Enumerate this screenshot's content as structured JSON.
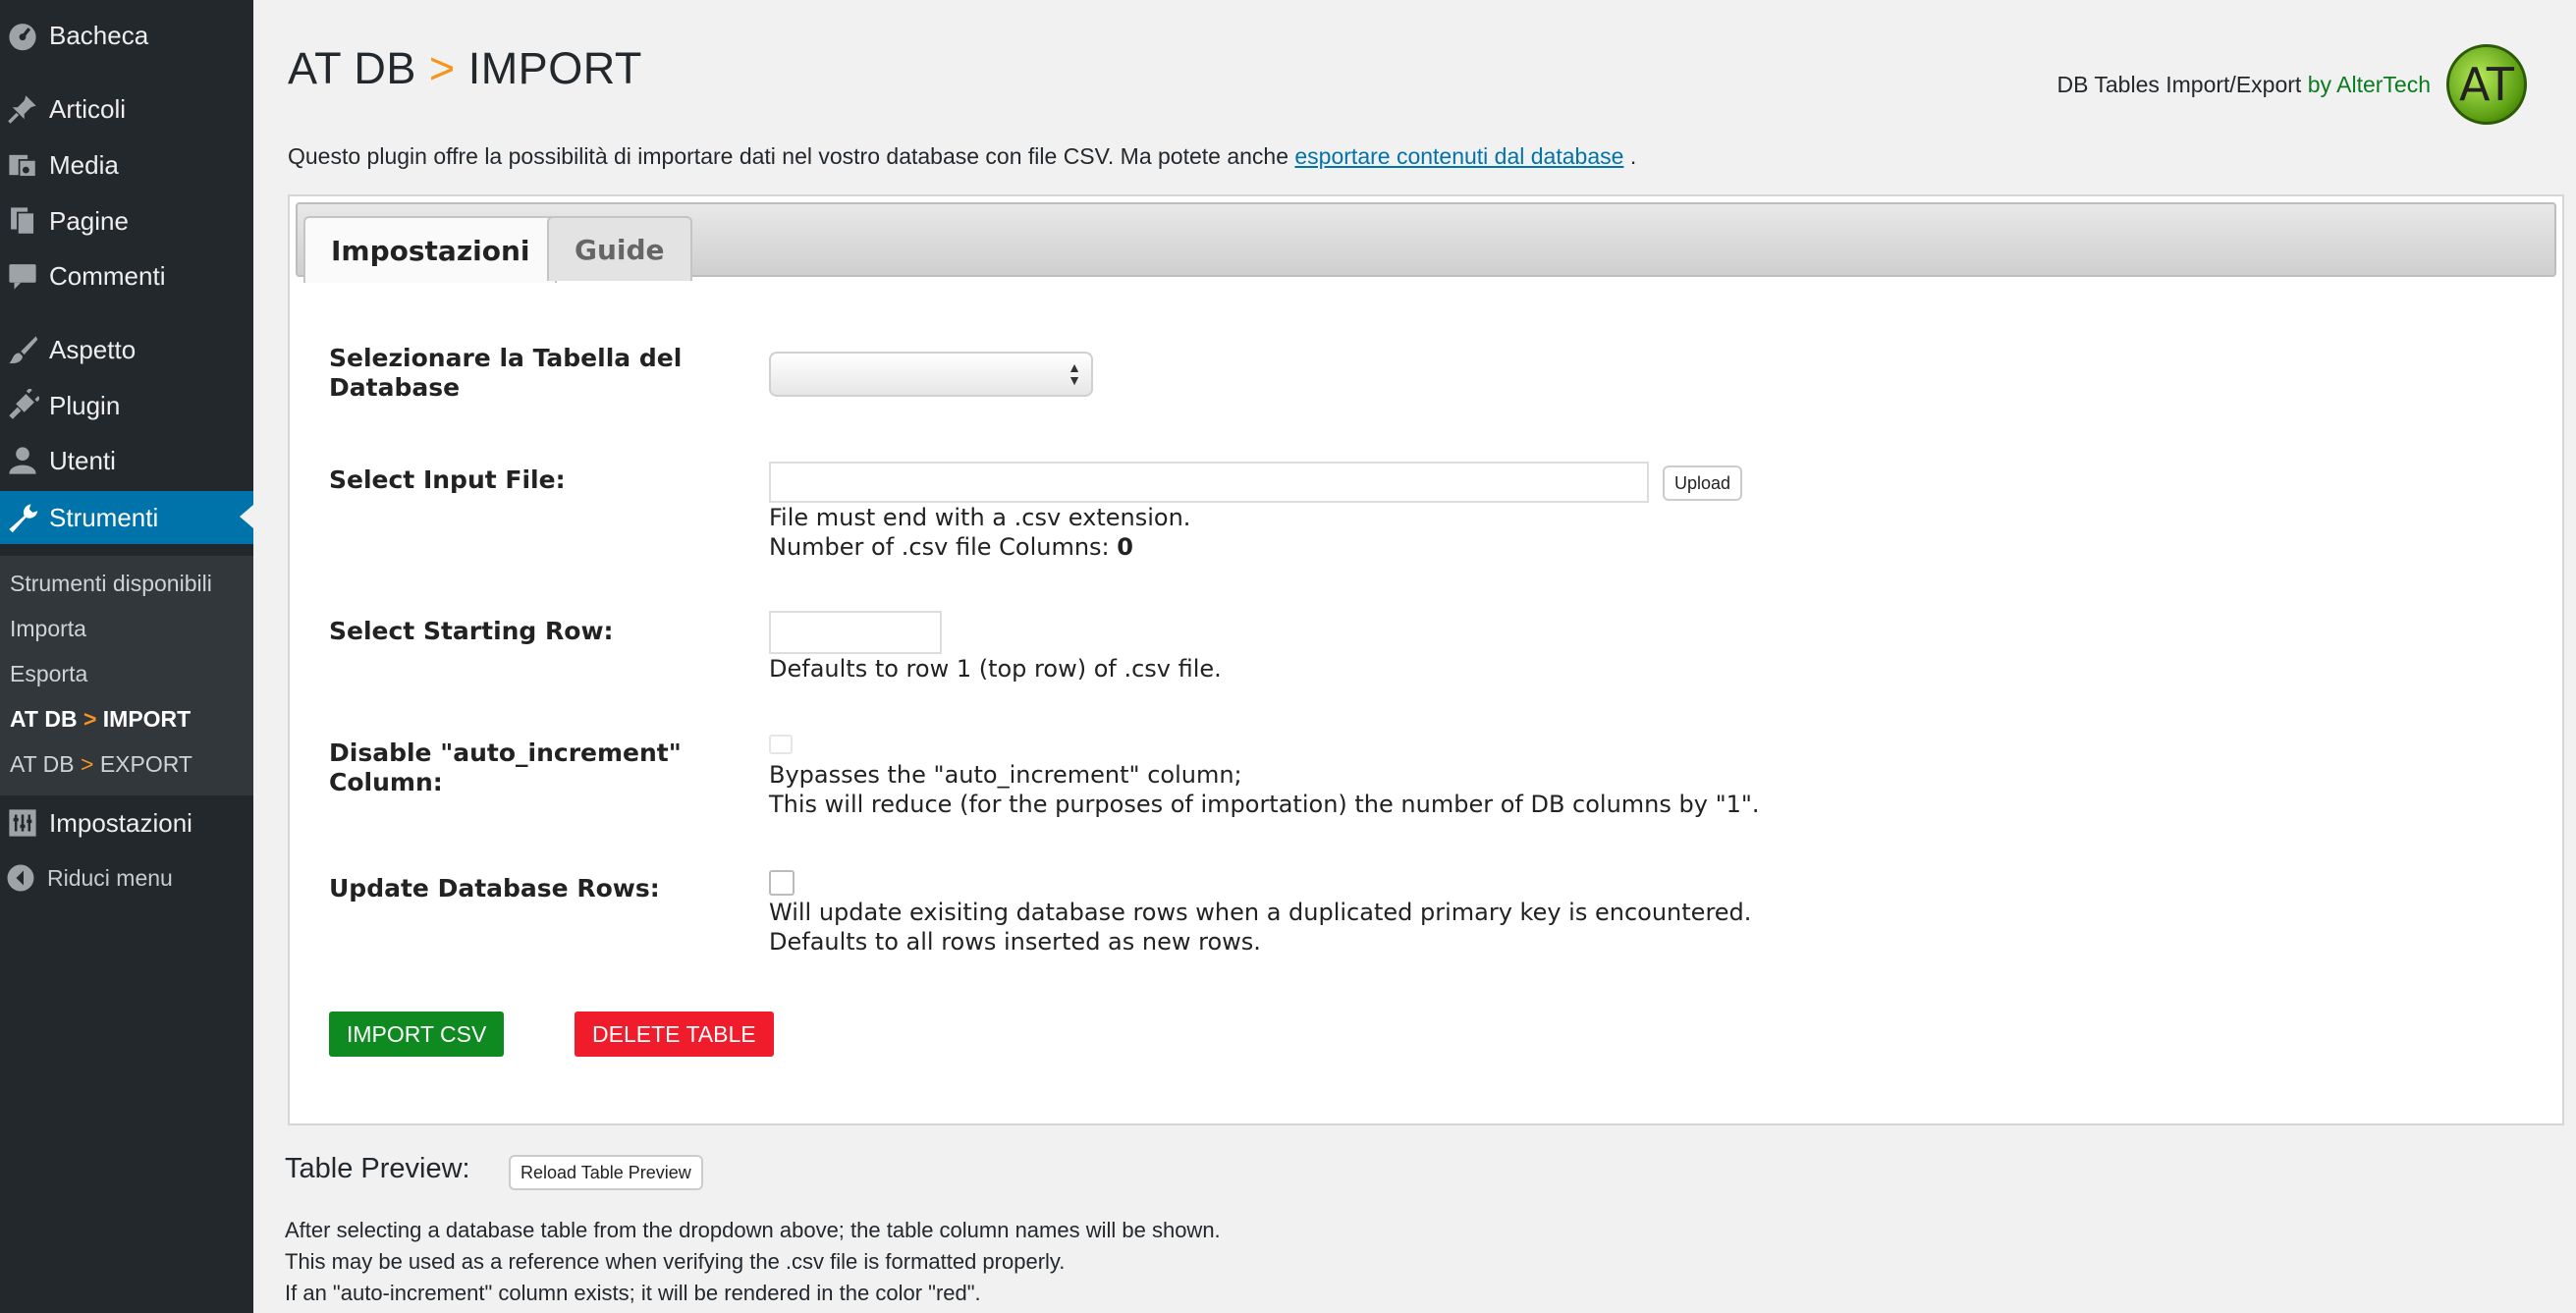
{
  "sidebar": {
    "items": [
      {
        "label": "Bacheca",
        "icon": "dashboard-icon"
      },
      {
        "label": "Articoli",
        "icon": "pin-icon"
      },
      {
        "label": "Media",
        "icon": "media-icon"
      },
      {
        "label": "Pagine",
        "icon": "pages-icon"
      },
      {
        "label": "Commenti",
        "icon": "comment-icon"
      },
      {
        "label": "Aspetto",
        "icon": "brush-icon"
      },
      {
        "label": "Plugin",
        "icon": "plugin-icon"
      },
      {
        "label": "Utenti",
        "icon": "user-icon"
      },
      {
        "label": "Strumenti",
        "icon": "wrench-icon"
      }
    ],
    "submenu": {
      "item0": "Strumenti disponibili",
      "item1": "Importa",
      "item2": "Esporta",
      "item3_prefix": "AT DB",
      "item3_suffix": "IMPORT",
      "item4_prefix": "AT DB",
      "item4_suffix": "EXPORT"
    },
    "impostazioni": "Impostazioni",
    "riduci": "Riduci menu",
    "gt": ">"
  },
  "header": {
    "title_prefix": "AT DB",
    "title_gt": ">",
    "title_suffix": "IMPORT",
    "brand_text": "DB Tables Import/Export",
    "brand_by": "by AlterTech",
    "logo_text": "AT"
  },
  "intro": {
    "text": "Questo plugin offre la possibilità di importare dati nel vostro database con file CSV. Ma potete anche",
    "link": "esportare contenuti dal database",
    "end": "."
  },
  "tabs": {
    "settings": "Impostazioni",
    "guide": "Guide"
  },
  "form": {
    "table_label_1": "Selezionare la Tabella del",
    "table_label_2": "Database",
    "table_value": "",
    "input_file_label": "Select Input File:",
    "upload_button": "Upload",
    "file_help": "File must end with a .csv extension.",
    "columns_label": "Number of .csv file Columns:",
    "columns_value": "0",
    "start_row_label": "Select Starting Row:",
    "start_row_value": "",
    "start_row_help": "Defaults to row 1 (top row) of .csv file.",
    "auto_inc_label_1": "Disable \"auto_increment\"",
    "auto_inc_label_2": "Column:",
    "auto_inc_help_1": "Bypasses the \"auto_increment\" column;",
    "auto_inc_help_2": "This will reduce (for the purposes of importation) the number of DB columns by \"1\".",
    "update_label": "Update Database Rows:",
    "update_help_1": "Will update exisiting database rows when a duplicated primary key is encountered.",
    "update_help_2": "Defaults to all rows inserted as new rows.",
    "import_button": "IMPORT CSV",
    "delete_button": "DELETE TABLE"
  },
  "preview": {
    "title": "Table Preview:",
    "reload_button": "Reload Table Preview",
    "line1": "After selecting a database table from the dropdown above; the table column names will be shown.",
    "line2": "This may be used as a reference when verifying the .csv file is formatted properly.",
    "line3": "If an \"auto-increment\" column exists; it will be rendered in the color \"red\"."
  },
  "colors": {
    "sidebar_bg": "#23282d",
    "active_menu": "#0073aa",
    "accent_orange": "#f7941e",
    "import_green": "#0f8a20",
    "delete_red": "#f01c2b"
  }
}
